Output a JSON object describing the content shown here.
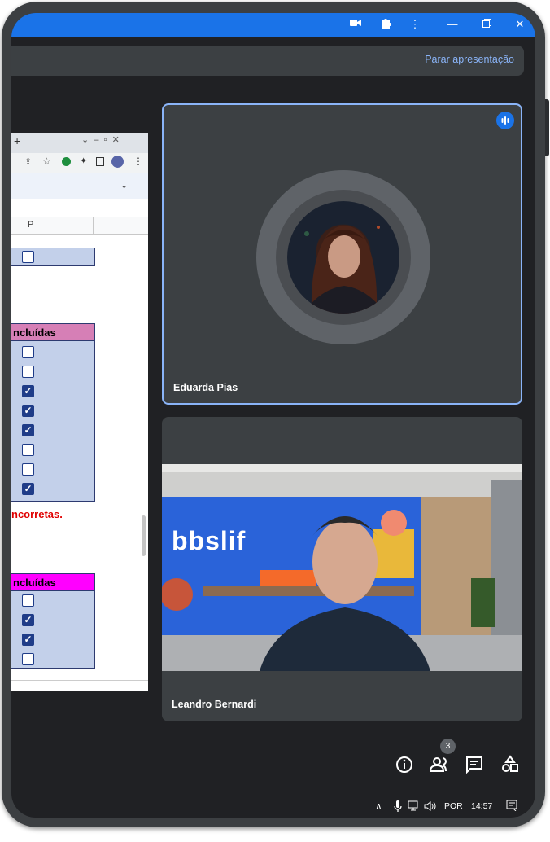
{
  "meeting": {
    "stop_presenting": "Parar apresentação"
  },
  "shared_screen": {
    "column_header": "P",
    "box_top": {
      "checkboxes": [
        false
      ]
    },
    "box1": {
      "title": "ncluídas",
      "checkboxes": [
        false,
        false,
        true,
        true,
        true,
        false,
        false,
        true
      ]
    },
    "warning": "ncorretas.",
    "box2": {
      "title": "ncluídas",
      "checkboxes": [
        false,
        true,
        true,
        false
      ]
    }
  },
  "participants": [
    {
      "name": "Eduarda Pias",
      "speaking": true
    },
    {
      "name": "Leandro Bernardi",
      "background_sign": "bbslif"
    }
  ],
  "controls": {
    "people_count": "3"
  },
  "taskbar": {
    "language": "POR",
    "time": "14:57"
  },
  "colors": {
    "accent": "#1a73e8",
    "link": "#8ab4f8",
    "tile": "#3c4043",
    "background": "#202124",
    "box1_header": "#d67fb6",
    "box2_header": "#ff00ff"
  }
}
